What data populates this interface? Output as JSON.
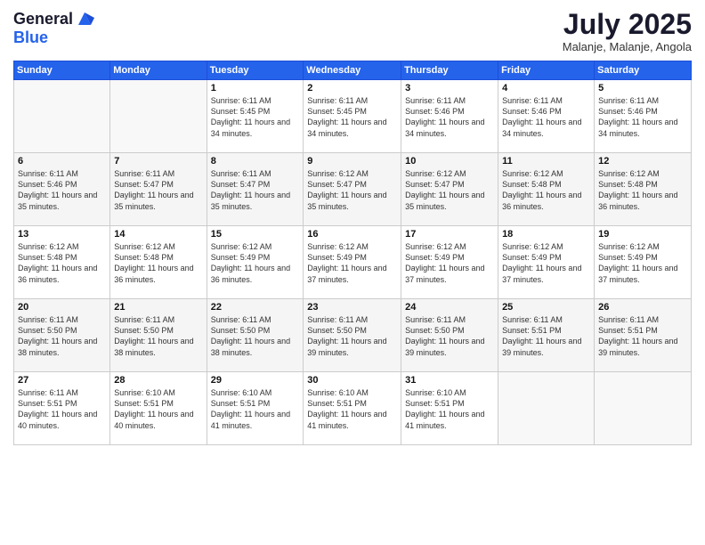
{
  "header": {
    "logo_general": "General",
    "logo_blue": "Blue",
    "title": "July 2025",
    "location": "Malanje, Malanje, Angola"
  },
  "days_of_week": [
    "Sunday",
    "Monday",
    "Tuesday",
    "Wednesday",
    "Thursday",
    "Friday",
    "Saturday"
  ],
  "weeks": [
    [
      {
        "day": "",
        "info": ""
      },
      {
        "day": "",
        "info": ""
      },
      {
        "day": "1",
        "info": "Sunrise: 6:11 AM\nSunset: 5:45 PM\nDaylight: 11 hours and 34 minutes."
      },
      {
        "day": "2",
        "info": "Sunrise: 6:11 AM\nSunset: 5:45 PM\nDaylight: 11 hours and 34 minutes."
      },
      {
        "day": "3",
        "info": "Sunrise: 6:11 AM\nSunset: 5:46 PM\nDaylight: 11 hours and 34 minutes."
      },
      {
        "day": "4",
        "info": "Sunrise: 6:11 AM\nSunset: 5:46 PM\nDaylight: 11 hours and 34 minutes."
      },
      {
        "day": "5",
        "info": "Sunrise: 6:11 AM\nSunset: 5:46 PM\nDaylight: 11 hours and 34 minutes."
      }
    ],
    [
      {
        "day": "6",
        "info": "Sunrise: 6:11 AM\nSunset: 5:46 PM\nDaylight: 11 hours and 35 minutes."
      },
      {
        "day": "7",
        "info": "Sunrise: 6:11 AM\nSunset: 5:47 PM\nDaylight: 11 hours and 35 minutes."
      },
      {
        "day": "8",
        "info": "Sunrise: 6:11 AM\nSunset: 5:47 PM\nDaylight: 11 hours and 35 minutes."
      },
      {
        "day": "9",
        "info": "Sunrise: 6:12 AM\nSunset: 5:47 PM\nDaylight: 11 hours and 35 minutes."
      },
      {
        "day": "10",
        "info": "Sunrise: 6:12 AM\nSunset: 5:47 PM\nDaylight: 11 hours and 35 minutes."
      },
      {
        "day": "11",
        "info": "Sunrise: 6:12 AM\nSunset: 5:48 PM\nDaylight: 11 hours and 36 minutes."
      },
      {
        "day": "12",
        "info": "Sunrise: 6:12 AM\nSunset: 5:48 PM\nDaylight: 11 hours and 36 minutes."
      }
    ],
    [
      {
        "day": "13",
        "info": "Sunrise: 6:12 AM\nSunset: 5:48 PM\nDaylight: 11 hours and 36 minutes."
      },
      {
        "day": "14",
        "info": "Sunrise: 6:12 AM\nSunset: 5:48 PM\nDaylight: 11 hours and 36 minutes."
      },
      {
        "day": "15",
        "info": "Sunrise: 6:12 AM\nSunset: 5:49 PM\nDaylight: 11 hours and 36 minutes."
      },
      {
        "day": "16",
        "info": "Sunrise: 6:12 AM\nSunset: 5:49 PM\nDaylight: 11 hours and 37 minutes."
      },
      {
        "day": "17",
        "info": "Sunrise: 6:12 AM\nSunset: 5:49 PM\nDaylight: 11 hours and 37 minutes."
      },
      {
        "day": "18",
        "info": "Sunrise: 6:12 AM\nSunset: 5:49 PM\nDaylight: 11 hours and 37 minutes."
      },
      {
        "day": "19",
        "info": "Sunrise: 6:12 AM\nSunset: 5:49 PM\nDaylight: 11 hours and 37 minutes."
      }
    ],
    [
      {
        "day": "20",
        "info": "Sunrise: 6:11 AM\nSunset: 5:50 PM\nDaylight: 11 hours and 38 minutes."
      },
      {
        "day": "21",
        "info": "Sunrise: 6:11 AM\nSunset: 5:50 PM\nDaylight: 11 hours and 38 minutes."
      },
      {
        "day": "22",
        "info": "Sunrise: 6:11 AM\nSunset: 5:50 PM\nDaylight: 11 hours and 38 minutes."
      },
      {
        "day": "23",
        "info": "Sunrise: 6:11 AM\nSunset: 5:50 PM\nDaylight: 11 hours and 39 minutes."
      },
      {
        "day": "24",
        "info": "Sunrise: 6:11 AM\nSunset: 5:50 PM\nDaylight: 11 hours and 39 minutes."
      },
      {
        "day": "25",
        "info": "Sunrise: 6:11 AM\nSunset: 5:51 PM\nDaylight: 11 hours and 39 minutes."
      },
      {
        "day": "26",
        "info": "Sunrise: 6:11 AM\nSunset: 5:51 PM\nDaylight: 11 hours and 39 minutes."
      }
    ],
    [
      {
        "day": "27",
        "info": "Sunrise: 6:11 AM\nSunset: 5:51 PM\nDaylight: 11 hours and 40 minutes."
      },
      {
        "day": "28",
        "info": "Sunrise: 6:10 AM\nSunset: 5:51 PM\nDaylight: 11 hours and 40 minutes."
      },
      {
        "day": "29",
        "info": "Sunrise: 6:10 AM\nSunset: 5:51 PM\nDaylight: 11 hours and 41 minutes."
      },
      {
        "day": "30",
        "info": "Sunrise: 6:10 AM\nSunset: 5:51 PM\nDaylight: 11 hours and 41 minutes."
      },
      {
        "day": "31",
        "info": "Sunrise: 6:10 AM\nSunset: 5:51 PM\nDaylight: 11 hours and 41 minutes."
      },
      {
        "day": "",
        "info": ""
      },
      {
        "day": "",
        "info": ""
      }
    ]
  ]
}
